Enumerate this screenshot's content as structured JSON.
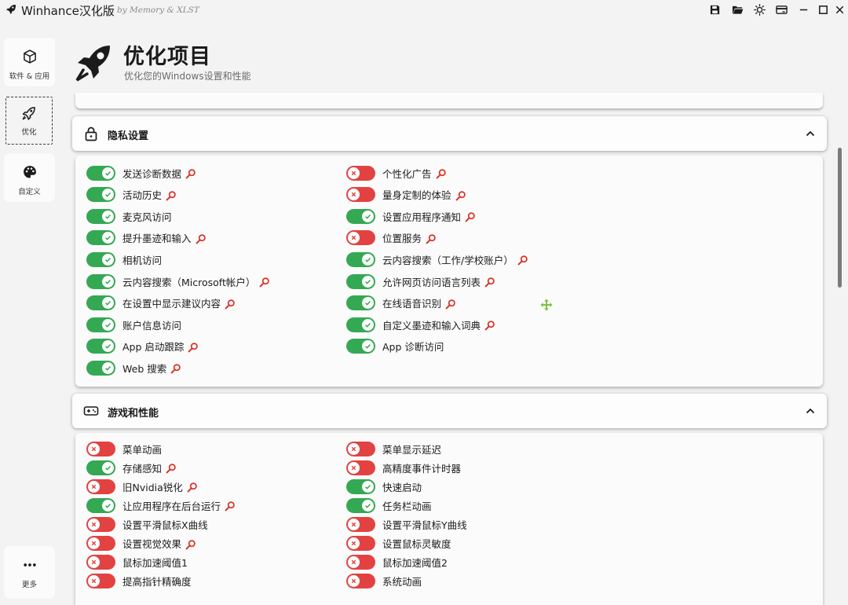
{
  "window": {
    "title": "Winhance汉化版",
    "byline": "by Memory & XLST"
  },
  "nav": [
    {
      "label": "软件 & 应用",
      "icon": "box-icon"
    },
    {
      "label": "优化",
      "icon": "rocket-icon"
    },
    {
      "label": "自定义",
      "icon": "palette-icon"
    },
    {
      "label": "更多",
      "icon": "more-dots-icon"
    }
  ],
  "header": {
    "title": "优化项目",
    "subtitle": "优化您的Windows设置和性能"
  },
  "sections": {
    "privacy": {
      "title": "隐私设置",
      "items": [
        {
          "label": "发送诊断数据",
          "on": true,
          "info": true
        },
        {
          "label": "个性化广告",
          "on": false,
          "info": true
        },
        {
          "label": "活动历史",
          "on": true,
          "info": true
        },
        {
          "label": "量身定制的体验",
          "on": false,
          "info": true
        },
        {
          "label": "麦克风访问",
          "on": true,
          "info": false
        },
        {
          "label": "设置应用程序通知",
          "on": true,
          "info": true
        },
        {
          "label": "提升墨迹和输入",
          "on": true,
          "info": true
        },
        {
          "label": "位置服务",
          "on": false,
          "info": true
        },
        {
          "label": "相机访问",
          "on": true,
          "info": false
        },
        {
          "label": "云内容搜索（工作/学校账户）",
          "on": true,
          "info": true
        },
        {
          "label": "云内容搜索（Microsoft帐户）",
          "on": true,
          "info": true
        },
        {
          "label": "允许网页访问语言列表",
          "on": true,
          "info": true
        },
        {
          "label": "在设置中显示建议内容",
          "on": true,
          "info": true
        },
        {
          "label": "在线语音识别",
          "on": true,
          "info": true
        },
        {
          "label": "账户信息访问",
          "on": true,
          "info": false
        },
        {
          "label": "自定义墨迹和输入词典",
          "on": true,
          "info": true
        },
        {
          "label": "App 启动跟踪",
          "on": true,
          "info": true
        },
        {
          "label": "App 诊断访问",
          "on": true,
          "info": false
        },
        {
          "label": "Web 搜索",
          "on": true,
          "info": true
        }
      ]
    },
    "gaming": {
      "title": "游戏和性能",
      "items": [
        {
          "label": "菜单动画",
          "on": false,
          "info": false
        },
        {
          "label": "菜单显示延迟",
          "on": false,
          "info": false
        },
        {
          "label": "存储感知",
          "on": true,
          "info": true
        },
        {
          "label": "高精度事件计时器",
          "on": false,
          "info": false
        },
        {
          "label": "旧Nvidia锐化",
          "on": false,
          "info": true
        },
        {
          "label": "快速启动",
          "on": true,
          "info": false
        },
        {
          "label": "让应用程序在后台运行",
          "on": true,
          "info": true
        },
        {
          "label": "任务栏动画",
          "on": true,
          "info": false
        },
        {
          "label": "设置平滑鼠标X曲线",
          "on": false,
          "info": false
        },
        {
          "label": "设置平滑鼠标Y曲线",
          "on": false,
          "info": false
        },
        {
          "label": "设置视觉效果",
          "on": false,
          "info": true
        },
        {
          "label": "设置鼠标灵敏度",
          "on": false,
          "info": false
        },
        {
          "label": "鼠标加速阈值1",
          "on": false,
          "info": false
        },
        {
          "label": "鼠标加速阈值2",
          "on": false,
          "info": false
        },
        {
          "label": "提高指针精确度",
          "on": false,
          "info": false
        },
        {
          "label": "系统动画",
          "on": false,
          "info": false
        }
      ]
    }
  },
  "colors": {
    "toggle_on": "#34a853",
    "toggle_off": "#e34242",
    "info_icon": "#d93025",
    "cursor": "#7cc242"
  }
}
